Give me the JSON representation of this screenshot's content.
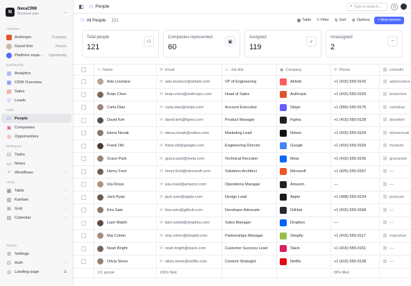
{
  "workspace": {
    "name": "NexaCRM",
    "subtitle": "Business plan",
    "logo": "N"
  },
  "sidebar": {
    "favorites_label": "Favorites",
    "favorites": [
      {
        "label": "Anthropic",
        "tag": "Company",
        "icon": "anthropic-logo",
        "color": "#e0552f"
      },
      {
        "label": "David Kim",
        "tag": "Person",
        "icon": "avatar",
        "color": "#c9b8a8"
      },
      {
        "label": "Platform expa...",
        "tag": "Opportunity",
        "icon": "target-icon",
        "color": "#4f6bff"
      }
    ],
    "dashboards_label": "Dashboards",
    "dashboards": [
      {
        "label": "Analytics",
        "icon": "chart-icon"
      },
      {
        "label": "CRM Overview",
        "icon": "layout-icon"
      },
      {
        "label": "Sales",
        "icon": "sales-icon"
      },
      {
        "label": "Leads",
        "icon": "funnel-icon"
      }
    ],
    "crm_label": "CRM",
    "crm": [
      {
        "label": "People",
        "icon": "people-icon",
        "active": true
      },
      {
        "label": "Companies",
        "icon": "building-icon"
      },
      {
        "label": "Opportunities",
        "icon": "target-icon"
      }
    ],
    "workspace_label": "Workspace",
    "workspace_items": [
      {
        "label": "Tasks",
        "icon": "check-icon"
      },
      {
        "label": "Notes",
        "icon": "note-icon"
      },
      {
        "label": "Workflows",
        "icon": "workflow-icon",
        "chevron": "›"
      }
    ],
    "views_label": "Views",
    "views": [
      {
        "label": "Table",
        "icon": "table-icon",
        "chevron": "›"
      },
      {
        "label": "Kanban",
        "icon": "kanban-icon",
        "chevron": "›"
      },
      {
        "label": "Grid",
        "icon": "grid-icon",
        "chevron": "›"
      },
      {
        "label": "Calendar",
        "icon": "calendar-icon",
        "chevron": "›"
      }
    ],
    "system_label": "System",
    "system": [
      {
        "label": "Settings",
        "icon": "gear-icon"
      },
      {
        "label": "Auth",
        "icon": "lock-icon",
        "chevron": "›"
      },
      {
        "label": "Landing page",
        "icon": "globe-icon"
      }
    ]
  },
  "topbar": {
    "title": "People",
    "search_placeholder": "Type to search..."
  },
  "viewbar": {
    "title": "All People",
    "count": "121",
    "table_label": "Table",
    "filter_label": "Filter",
    "sort_label": "Sort",
    "options_label": "Options",
    "new_label": "+ New person"
  },
  "cards": [
    {
      "label": "Total people",
      "value": "121",
      "icon": "people-icon"
    },
    {
      "label": "Companies represented",
      "value": "60",
      "icon": "building-icon"
    },
    {
      "label": "Assigned",
      "value": "119",
      "icon": "user-check-icon"
    },
    {
      "label": "Unassigned",
      "value": "2",
      "icon": "user-minus-icon"
    }
  ],
  "table": {
    "headers": {
      "name": "Name",
      "email": "Email",
      "job": "Job title",
      "company": "Company",
      "phone": "Phone",
      "linkedin": "LinkedIn"
    },
    "rows": [
      {
        "name": "Ada Lovelace",
        "email": "ada.lovelace@airbnb.com",
        "job": "VP of Engineering",
        "company": "Airbnb",
        "logo": "#ff5a5f",
        "phone": "+1 (415) 555-0142",
        "linkedin": "adalovelace",
        "avatar": "#b8a48f"
      },
      {
        "name": "Brian Chen",
        "email": "brian.chen@anthropic.com",
        "job": "Head of Sales",
        "company": "Anthropic",
        "logo": "#e0552f",
        "phone": "+1 (415) 555-0193",
        "linkedin": "brianchen",
        "avatar": "#7a6a5e"
      },
      {
        "name": "Carla Diaz",
        "email": "carla.diaz@stripe.com",
        "job": "Account Executive",
        "company": "Stripe",
        "logo": "#635bff",
        "phone": "+1 (555) 555-0176",
        "linkedin": "carladiaz",
        "avatar": "#a18775"
      },
      {
        "name": "David Kim",
        "email": "david.kim@figma.com",
        "job": "Product Manager",
        "company": "Figma",
        "logo": "#1e1e1e",
        "phone": "+1 (415) 555-0128",
        "linkedin": "davidkim",
        "avatar": "#5d5149"
      },
      {
        "name": "Elena Novak",
        "email": "elena.novak@notion.com",
        "job": "Marketing Lead",
        "company": "Notion",
        "logo": "#111111",
        "phone": "+1 (415) 555-0164",
        "linkedin": "elenanovak",
        "avatar": "#8c7a6c"
      },
      {
        "name": "Frank Obi",
        "email": "frank.obi@google.com",
        "job": "Engineering Director",
        "company": "Google",
        "logo": "#4285f4",
        "phone": "+1 (415) 555-0109",
        "linkedin": "frankobi",
        "avatar": "#4b3d33"
      },
      {
        "name": "Grace Park",
        "email": "grace.park@meta.com",
        "job": "Technical Recruiter",
        "company": "Meta",
        "logo": "#0866ff",
        "phone": "+1 (415) 555-0155",
        "linkedin": "gracepark",
        "avatar": "#9c8574"
      },
      {
        "name": "Henry Ford",
        "email": "henry.ford@microsoft.com",
        "job": "Solutions Architect",
        "company": "Microsoft",
        "logo": "#f35325",
        "phone": "+1 (425) 555-0187",
        "linkedin": "—",
        "avatar": "#6f6259"
      },
      {
        "name": "Isla Rossi",
        "email": "isla.rossi@amazon.com",
        "job": "Operations Manager",
        "company": "Amazon",
        "logo": "#222222",
        "phone": "—",
        "linkedin": "—",
        "avatar": "#b09480"
      },
      {
        "name": "Jack Ryan",
        "email": "jack.ryan@apple.com",
        "job": "Design Lead",
        "company": "Apple",
        "logo": "#1a1a1a",
        "phone": "+1 (408) 555-0134",
        "linkedin": "jackryan",
        "avatar": "#6a5a4e"
      },
      {
        "name": "Kira Sato",
        "email": "kira.sato@github.com",
        "job": "Developer Advocate",
        "company": "GitHub",
        "logo": "#24292f",
        "phone": "+1 (415) 555-0168",
        "linkedin": "—",
        "avatar": "#8e7868"
      },
      {
        "name": "Liam Walsh",
        "email": "liam.walsh@dropbox.com",
        "job": "Sales Manager",
        "company": "Dropbox",
        "logo": "#0061ff",
        "phone": "—",
        "linkedin": "—",
        "avatar": "#5a4c43"
      },
      {
        "name": "Mia Cohen",
        "email": "mia.cohen@shopify.com",
        "job": "Partnerships Manager",
        "company": "Shopify",
        "logo": "#95bf47",
        "phone": "+1 (415) 555-0117",
        "linkedin": "miacohen",
        "avatar": "#a68d7b"
      },
      {
        "name": "Noah Bright",
        "email": "noah.bright@slack.com",
        "job": "Customer Success Lead",
        "company": "Slack",
        "logo": "#e01e5a",
        "phone": "+1 (415) 555-0151",
        "linkedin": "—",
        "avatar": "#74665c"
      },
      {
        "name": "Olivia Stone",
        "email": "olivia.stone@netflix.com",
        "job": "Content Strategist",
        "company": "Netflix",
        "logo": "#e50914",
        "phone": "+1 (415) 555-0138",
        "linkedin": "—",
        "avatar": "#9a8270"
      }
    ],
    "footer": {
      "count": "121 people",
      "email": "100% filled",
      "phone": "86% filled"
    }
  }
}
